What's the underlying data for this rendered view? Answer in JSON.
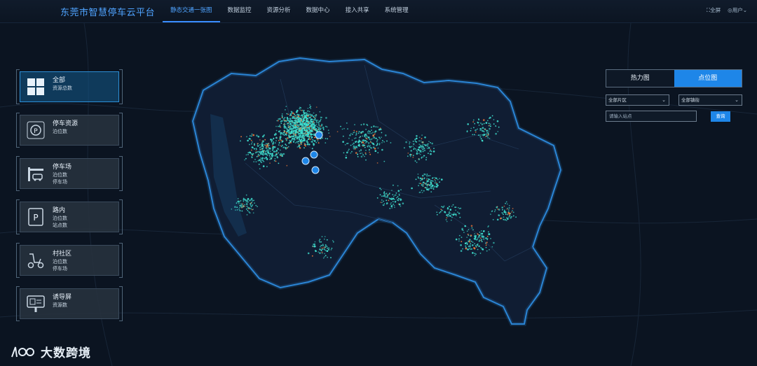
{
  "header": {
    "title": "东莞市智慧停车云平台",
    "nav": [
      "静态交通一张图",
      "数据监控",
      "资源分析",
      "数据中心",
      "接入共享",
      "系统管理"
    ],
    "active_nav": 0,
    "fullscreen_label": "全屏",
    "user_label": "用户"
  },
  "categories": [
    {
      "title": "全部",
      "subs": [
        "资源总数"
      ],
      "icon": "grid-icon",
      "active": true
    },
    {
      "title": "停车资源",
      "subs": [
        "泊位数"
      ],
      "icon": "parking-circle-icon"
    },
    {
      "title": "停车场",
      "subs": [
        "泊位数",
        "停车场"
      ],
      "icon": "parking-lot-gate-icon"
    },
    {
      "title": "路内",
      "subs": [
        "泊位数",
        "站点数"
      ],
      "icon": "roadside-parking-icon"
    },
    {
      "title": "村社区",
      "subs": [
        "泊位数",
        "停车场"
      ],
      "icon": "scooter-icon"
    },
    {
      "title": "诱导屏",
      "subs": [
        "资源数"
      ],
      "icon": "guidance-screen-icon"
    }
  ],
  "map_controls": {
    "modes": [
      "热力图",
      "点位图"
    ],
    "active_mode": 1,
    "district_select": "全部片区",
    "street_select": "全部镇街",
    "search_placeholder": "请输入站点",
    "search_button": "查询"
  },
  "colors": {
    "accent": "#1e86e8",
    "boundary": "#2f8fe6",
    "point_cyan": "#3fe0d0",
    "point_orange": "#f07a3a"
  },
  "watermark": {
    "text": "大数跨境"
  }
}
